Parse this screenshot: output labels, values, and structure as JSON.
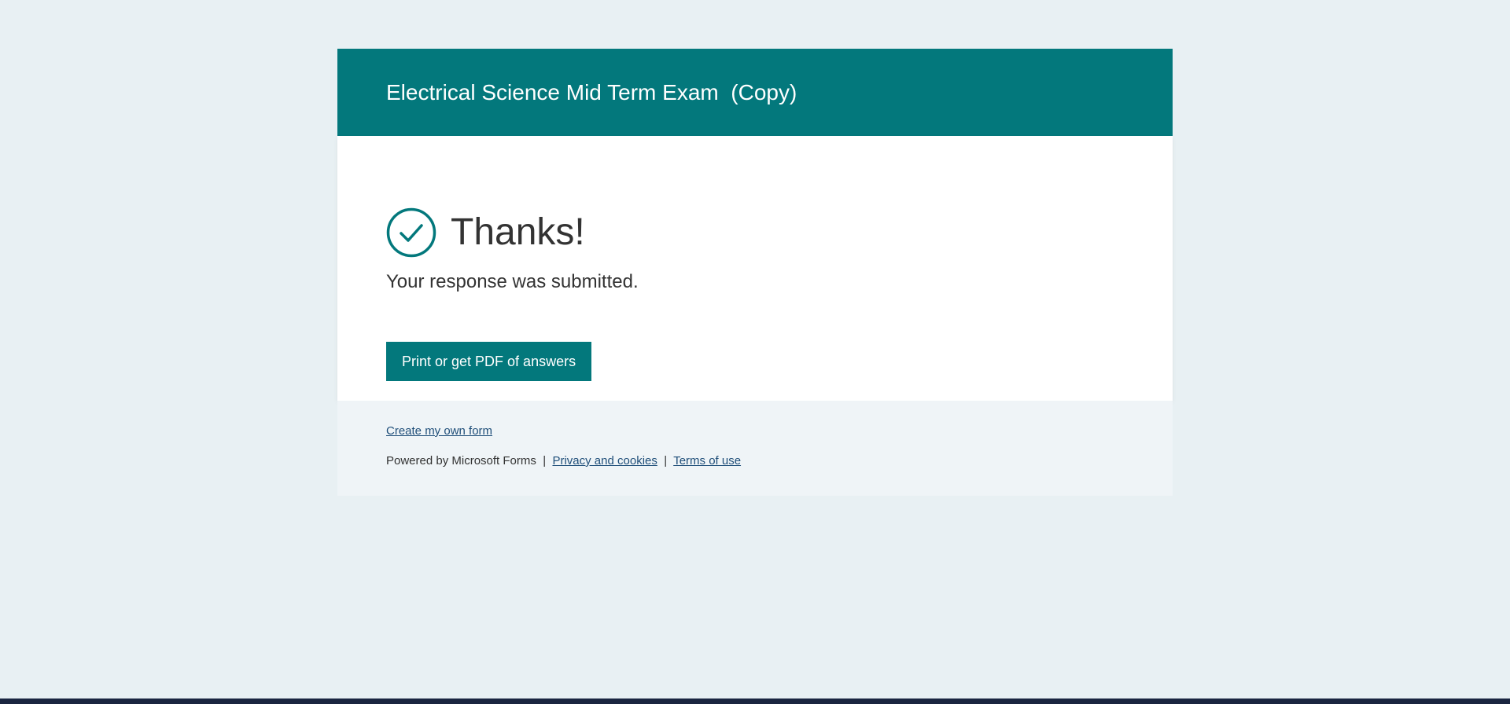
{
  "header": {
    "title": "Electrical Science Mid Term Exam  (Copy)"
  },
  "confirmation": {
    "icon": "check-circle-icon",
    "heading": "Thanks!",
    "message": "Your response was submitted.",
    "print_button_label": "Print or get PDF of answers"
  },
  "footer": {
    "create_link": "Create my own form",
    "powered_by": "Powered by Microsoft Forms",
    "separator": "|",
    "privacy_link": "Privacy and cookies",
    "terms_link": "Terms of use"
  },
  "colors": {
    "accent": "#03787c",
    "page_background": "#e8f0f3",
    "link": "#1f4e79"
  }
}
